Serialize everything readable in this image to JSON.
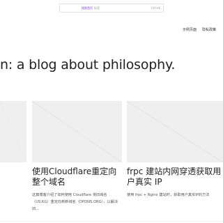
{
  "search": {
    "prefix": "搜索首页",
    "placeholder": "标签",
    "shortcut": "Ctrl+K"
  },
  "nav": {
    "items": [
      {
        "label": "示例页面"
      },
      {
        "label": "隐私政策"
      }
    ]
  },
  "hero": {
    "title": "n: a blog about philosophy."
  },
  "posts": [
    {
      "title": "",
      "excerpt": ""
    },
    {
      "title": "使用Cloudflare重定向整个域名",
      "excerpt": "这篇博客介绍了如何使用 Cloudflare 将旧域名（US.KG）重定向到新域名（DPDNS.ORG），以解决旧..."
    },
    {
      "title": "frpc 建站内网穿透获取用户真实 IP",
      "excerpt": "使用 frpc + Nginx 建站时，获取用户真实IP的方法"
    }
  ]
}
